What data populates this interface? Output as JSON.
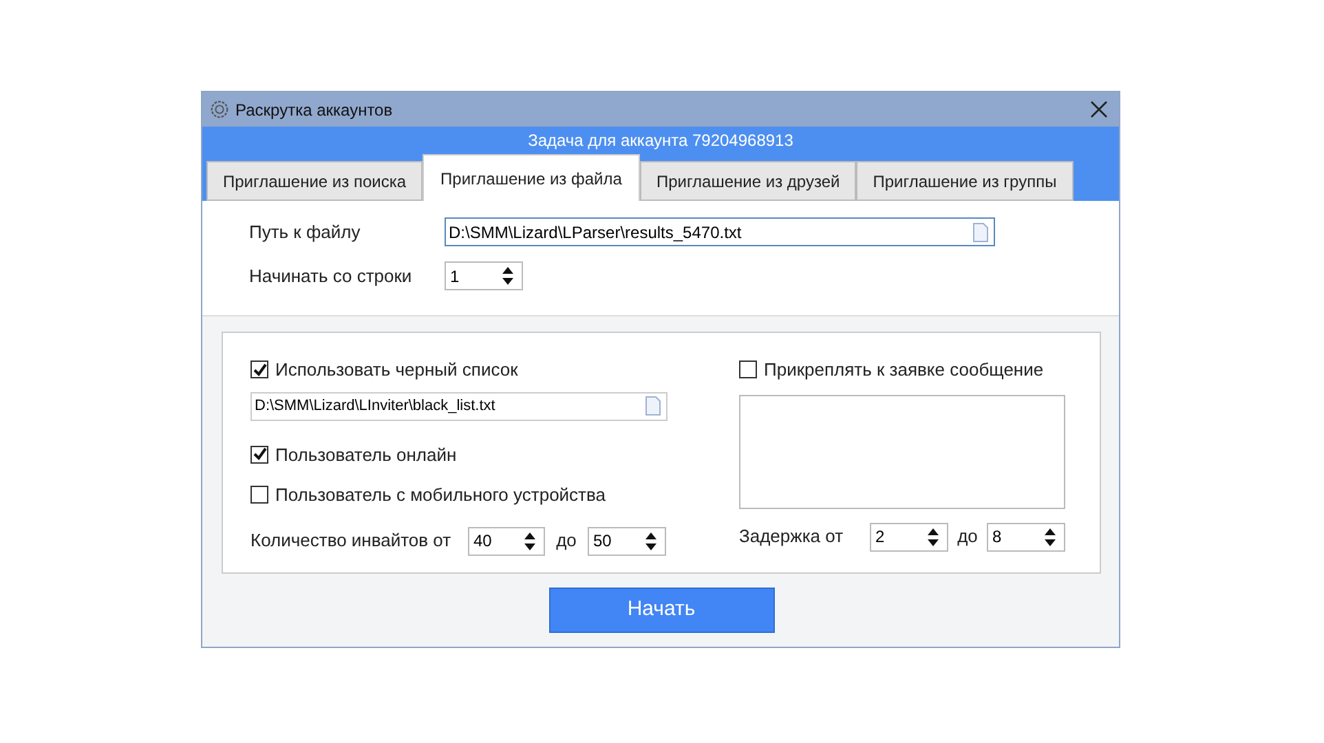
{
  "window": {
    "title": "Раскрутка аккаунтов"
  },
  "header": "Задача для аккаунта 79204968913",
  "tabs": [
    {
      "label": "Приглашение из поиска",
      "selected": false
    },
    {
      "label": "Приглашение из файла",
      "selected": true
    },
    {
      "label": "Приглашение из друзей",
      "selected": false
    },
    {
      "label": "Приглашение из группы",
      "selected": false
    }
  ],
  "file_path": {
    "label": "Путь к файлу",
    "value": "D:\\SMM\\Lizard\\LParser\\results_5470.txt"
  },
  "start_line": {
    "label": "Начинать со строки",
    "value": "1"
  },
  "blacklist": {
    "label": "Использовать черный список",
    "checked": true,
    "path": "D:\\SMM\\Lizard\\LInviter\\black_list.txt"
  },
  "options": [
    {
      "label": "Пользователь онлайн",
      "checked": true
    },
    {
      "label": "Пользователь с мобильного устройства",
      "checked": false
    }
  ],
  "invites": {
    "label": "Количество инвайтов от",
    "from": "40",
    "to_label": "до",
    "to": "50"
  },
  "message": {
    "label": "Прикреплять к заявке сообщение",
    "checked": false
  },
  "delay": {
    "label": "Задержка от",
    "from": "2",
    "to_label": "до",
    "to": "8"
  },
  "start_button": "Начать"
}
